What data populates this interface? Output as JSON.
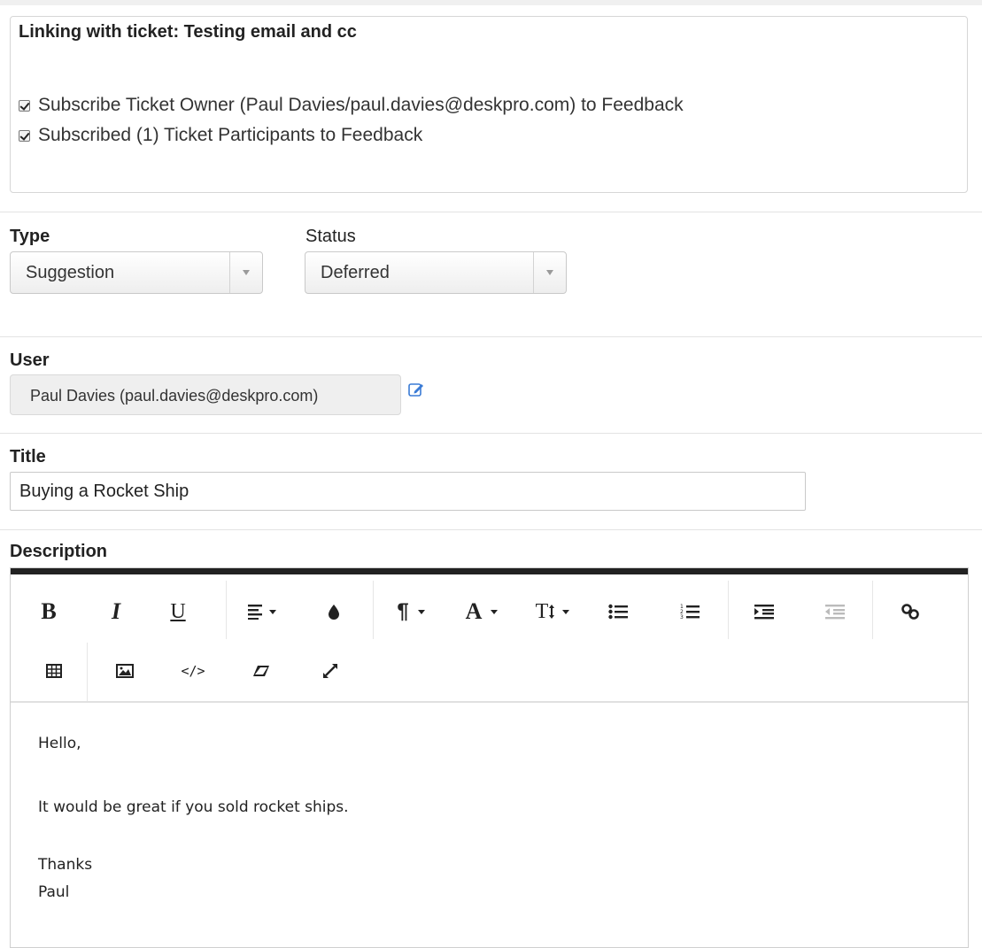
{
  "link_panel": {
    "title": "Linking with ticket: Testing email and cc",
    "check1": "Subscribe Ticket Owner (Paul Davies/paul.davies@deskpro.com) to Feedback",
    "check2": "Subscribed (1) Ticket Participants to Feedback"
  },
  "type": {
    "label": "Type",
    "value": "Suggestion"
  },
  "status": {
    "label": "Status",
    "value": "Deferred"
  },
  "user": {
    "label": "User",
    "value": "Paul Davies (paul.davies@deskpro.com)"
  },
  "title_field": {
    "label": "Title",
    "value": "Buying a Rocket Ship"
  },
  "description": {
    "label": "Description",
    "toolbar": {
      "bold": "B",
      "italic": "I",
      "underline": "U",
      "paragraph": "¶",
      "font_family": "A",
      "font_size": "T"
    },
    "body": [
      "Hello,",
      "It would be great if you sold rocket ships.",
      "Thanks",
      "Paul"
    ]
  }
}
